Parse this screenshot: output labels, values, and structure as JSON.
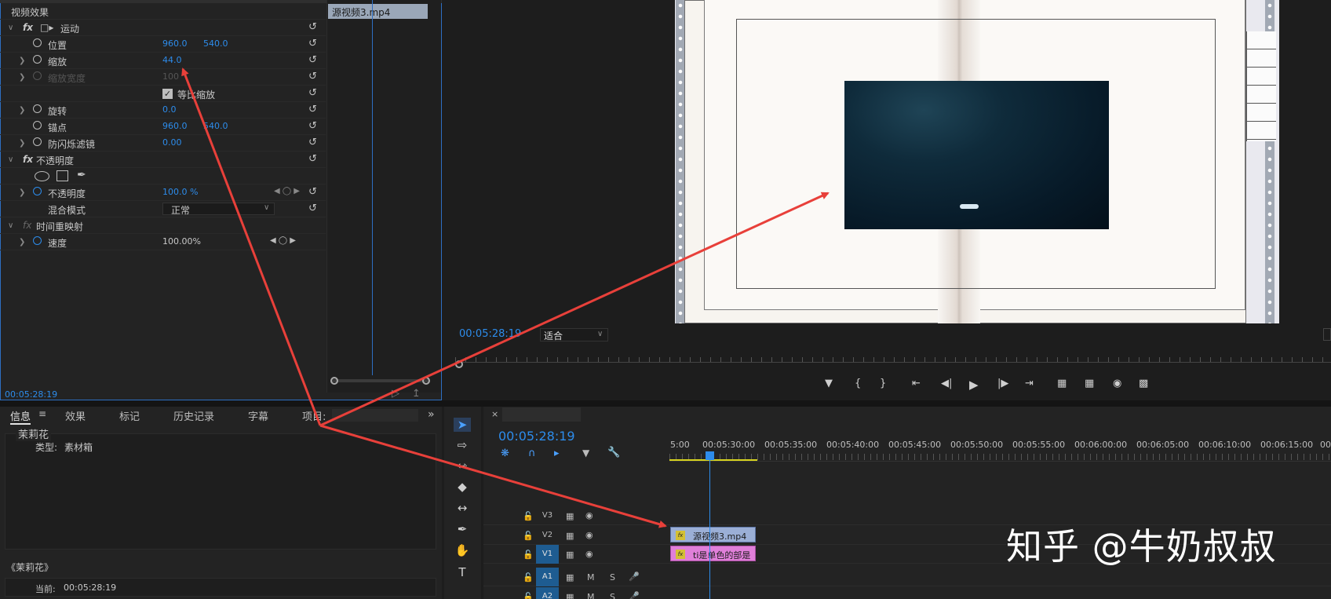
{
  "effect_controls": {
    "header": "视频效果",
    "source_clip_tab": "源视频3.mp4",
    "timecode": "00:05:28:19",
    "motion": {
      "label": "运动",
      "position": {
        "label": "位置",
        "x": "960.0",
        "y": "540.0"
      },
      "scale": {
        "label": "缩放",
        "value": "44.0"
      },
      "scale_width": {
        "label": "缩放宽度",
        "value": "100"
      },
      "uniform_scale": {
        "label": "等比缩放",
        "checked": true
      },
      "rotation": {
        "label": "旋转",
        "value": "0.0"
      },
      "anchor": {
        "label": "锚点",
        "x": "960.0",
        "y": "540.0"
      },
      "anti_flicker": {
        "label": "防闪烁滤镜",
        "value": "0.00"
      }
    },
    "opacity": {
      "label": "不透明度",
      "opacity": {
        "label": "不透明度",
        "value": "100.0 %"
      },
      "blend_mode": {
        "label": "混合模式",
        "value": "正常"
      }
    },
    "time_remap": {
      "label": "时间重映射",
      "speed": {
        "label": "速度",
        "value": "100.00%"
      }
    }
  },
  "program_monitor": {
    "timecode": "00:05:28:19",
    "fit": "适合"
  },
  "info_panel": {
    "tabs": [
      "信息",
      "效果",
      "标记",
      "历史记录",
      "字幕",
      "项目:"
    ],
    "item_name": "茉莉花",
    "type_label": "类型:",
    "type_value": "素材箱",
    "breadcrumb": "《茉莉花》",
    "current_label": "当前:",
    "current_time": "00:05:28:19"
  },
  "timeline": {
    "timecode": "00:05:28:19",
    "ruler_labels": [
      "5:00",
      "00:05:30:00",
      "00:05:35:00",
      "00:05:40:00",
      "00:05:45:00",
      "00:05:50:00",
      "00:05:55:00",
      "00:06:00:00",
      "00:06:05:00",
      "00:06:10:00",
      "00:06:15:00",
      "00:"
    ],
    "tracks": {
      "v3": "V3",
      "v2": "V2",
      "v1": "V1",
      "a1": "A1",
      "a2": "A2",
      "m": "M",
      "s": "S"
    },
    "clips": {
      "v2_clip": "源视频3.mp4",
      "v1_clip": "ti是单色的部是",
      "fx_badge": "fx"
    }
  },
  "watermark": "知乎 @牛奶叔叔",
  "colors": {
    "accent_blue": "#2d8ceb",
    "panel_border": "#2d6fc2",
    "annotation_red": "#e8403a",
    "clip_v2": "#9bafd6",
    "clip_v1": "#e07fd9"
  }
}
